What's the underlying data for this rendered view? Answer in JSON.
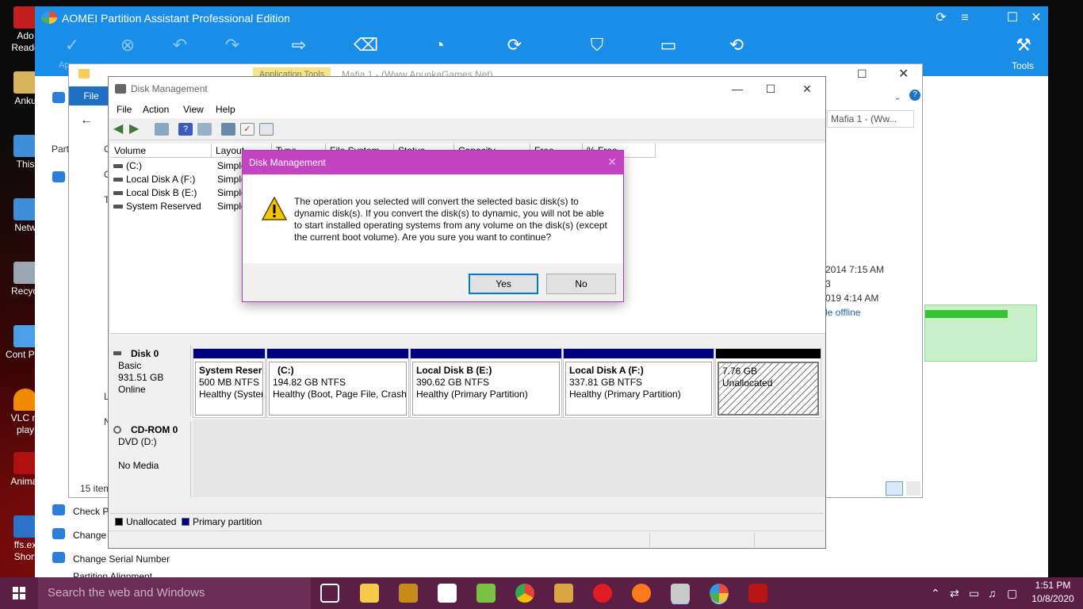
{
  "desktop": {
    "icons": [
      "Ado Reade",
      "Anku",
      "This",
      "Netw",
      "Recycl",
      "Cont Pan",
      "VLC m play",
      "Animat",
      "ffs.ex Short"
    ]
  },
  "aomei": {
    "title": "AOMEI Partition Assistant Professional Edition",
    "tools_label": "Tools",
    "apply_label": "Ap",
    "side_items": [
      "Check Pa",
      "Change P",
      "Change Serial Number",
      "Partition Alignment"
    ]
  },
  "explorer": {
    "app_tools": "Application Tools",
    "title": "Mafia 1 - (Www.AnunkaGames.Net)",
    "file_tab": "File",
    "search_placeholder": "Mafia 1 - (Ww...",
    "items_count": "15 item",
    "nav_items": [
      "Part",
      "C",
      "O",
      "T",
      "L",
      "N"
    ],
    "details_right": [
      "2014 7:15 AM",
      "3",
      "019 4:14 AM",
      "le offline"
    ]
  },
  "dm": {
    "title": "Disk Management",
    "menu": [
      "File",
      "Action",
      "View",
      "Help"
    ],
    "columns": [
      "Volume",
      "Layout",
      "Type",
      "File System",
      "Status",
      "Capacity",
      "Free Space",
      "% Free"
    ],
    "volumes": [
      {
        "name": "(C:)",
        "layout": "Simple"
      },
      {
        "name": "Local Disk A (F:)",
        "layout": "Simple"
      },
      {
        "name": "Local Disk B (E:)",
        "layout": "Simple"
      },
      {
        "name": "System Reserved",
        "layout": "Simple"
      }
    ],
    "disk0": {
      "name": "Disk 0",
      "type": "Basic",
      "size": "931.51 GB",
      "status": "Online",
      "partitions": [
        {
          "title": "System Reser",
          "size": "500 MB NTFS",
          "status": "Healthy (Syster"
        },
        {
          "title": "(C:)",
          "size": "194.82 GB NTFS",
          "status": "Healthy (Boot, Page File, Crash"
        },
        {
          "title": "Local Disk B  (E:)",
          "size": "390.62 GB NTFS",
          "status": "Healthy (Primary Partition)"
        },
        {
          "title": "Local Disk A  (F:)",
          "size": "337.81 GB NTFS",
          "status": "Healthy (Primary Partition)"
        },
        {
          "title": "",
          "size": "7.76 GB",
          "status": "Unallocated"
        }
      ]
    },
    "cdrom": {
      "name": "CD-ROM 0",
      "type": "DVD (D:)",
      "status": "No Media"
    },
    "legend": {
      "unallocated": "Unallocated",
      "primary": "Primary partition",
      "unallocated_color": "#000000",
      "primary_color": "#000080"
    }
  },
  "dialog": {
    "title": "Disk Management",
    "message": "The operation you selected will convert the selected basic disk(s) to dynamic disk(s). If you convert the disk(s) to dynamic, you will not be able to start installed operating systems from any volume on the disk(s) (except the current boot volume). Are you sure you want to continue?",
    "yes": "Yes",
    "no": "No",
    "accent": "#c443c2"
  },
  "taskbar": {
    "search_placeholder": "Search the web and Windows",
    "time": "1:51 PM",
    "date": "10/8/2020",
    "color": "#5b1f45"
  }
}
